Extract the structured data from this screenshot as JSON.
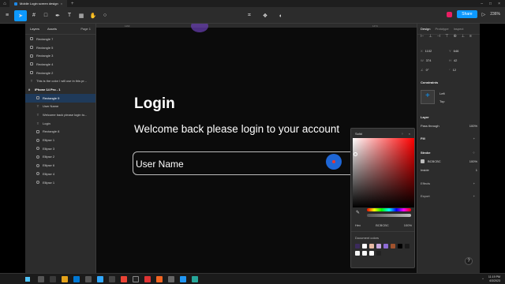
{
  "titlebar": {
    "tab_title": "Mobile Login screen design"
  },
  "toolbar": {
    "share_label": "Share",
    "zoom": "236%"
  },
  "left_panel": {
    "tab_layers": "Layers",
    "tab_assets": "Assets",
    "page": "Page 1",
    "layers": [
      {
        "label": "Rectangle 7",
        "kind": "rect"
      },
      {
        "label": "Rectangle 5",
        "kind": "rect"
      },
      {
        "label": "Rectangle 3",
        "kind": "rect"
      },
      {
        "label": "Rectangle 4",
        "kind": "rect"
      },
      {
        "label": "Rectangle 2",
        "kind": "rect"
      },
      {
        "label": "This is the color I will use in this pr...",
        "kind": "text"
      },
      {
        "label": "iPhone 14 Pro - 1",
        "kind": "frame"
      },
      {
        "label": "Rectangle 9",
        "kind": "rect",
        "selected": true
      },
      {
        "label": "User Name",
        "kind": "text"
      },
      {
        "label": "Welcome back please login to...",
        "kind": "text"
      },
      {
        "label": "Login",
        "kind": "text"
      },
      {
        "label": "Rectangle 8",
        "kind": "rect"
      },
      {
        "label": "Ellipse 1",
        "kind": "circle"
      },
      {
        "label": "Ellipse 3",
        "kind": "circle"
      },
      {
        "label": "Ellipse 2",
        "kind": "circle"
      },
      {
        "label": "Ellipse 6",
        "kind": "circle"
      },
      {
        "label": "Ellipse 4",
        "kind": "circle"
      },
      {
        "label": "Ellipse 1",
        "kind": "circle"
      }
    ]
  },
  "canvas": {
    "ruler_marks": [
      "1163",
      "1474"
    ],
    "login_title": "Login",
    "welcome_text": "Welcome back please login to your account",
    "username_label": "User Name"
  },
  "color_picker": {
    "mode": "Solid",
    "format": "Hex",
    "hex": "BCBCBC",
    "opacity": "100%",
    "doc_colors_label": "Document colors",
    "swatches": [
      "#3b2a5c",
      "#ffffff",
      "#e7b9a3",
      "#c6a6e0",
      "#8e6bd6",
      "#a0522d",
      "#000000",
      "#1a1a1a",
      "#f5f5f5",
      "#fafafa",
      "#ffffff",
      "#222222"
    ]
  },
  "right_panel": {
    "tab_design": "Design",
    "tab_prototype": "Prototype",
    "tab_inspect": "Inspect",
    "x": "1102",
    "y": "646",
    "w": "374",
    "h": "42",
    "rotation": "0°",
    "radius": "12",
    "constraints_label": "Constraints",
    "constraint_h": "Left",
    "constraint_v": "Top",
    "layer_label": "Layer",
    "blend": "Pass through",
    "layer_opacity": "100%",
    "fill_label": "Fill",
    "stroke_label": "Stroke",
    "stroke_hex": "BCBCBC",
    "stroke_opacity": "100%",
    "stroke_position": "Inside",
    "stroke_width": "1",
    "effects_label": "Effects",
    "export_label": "Export"
  },
  "taskbar": {
    "time": "11:19 PM",
    "date": "4/3/2023"
  }
}
